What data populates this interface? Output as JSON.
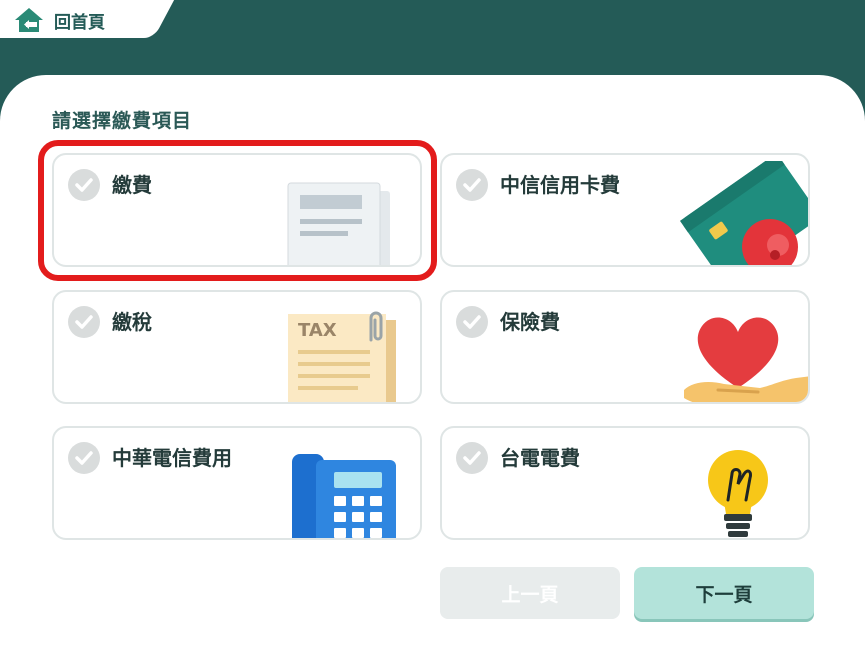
{
  "header": {
    "home_label": "回首頁"
  },
  "heading": "請選擇繳費項目",
  "cards": [
    {
      "label": "繳費"
    },
    {
      "label": "中信信用卡費"
    },
    {
      "label": "繳稅",
      "tax_text": "TAX"
    },
    {
      "label": "保險費"
    },
    {
      "label": "中華電信費用"
    },
    {
      "label": "台電電費"
    }
  ],
  "footer": {
    "prev_label": "上一頁",
    "next_label": "下一頁"
  },
  "colors": {
    "brand": "#245b57",
    "highlight": "#e31c1c",
    "next_button": "#b3e3da",
    "check_inactive": "#d9dcdc"
  },
  "icons": [
    "home-icon",
    "check-icon",
    "receipt-icon",
    "credit-card-icon",
    "tax-document-icon",
    "heart-hand-icon",
    "telephone-icon",
    "light-bulb-icon"
  ]
}
